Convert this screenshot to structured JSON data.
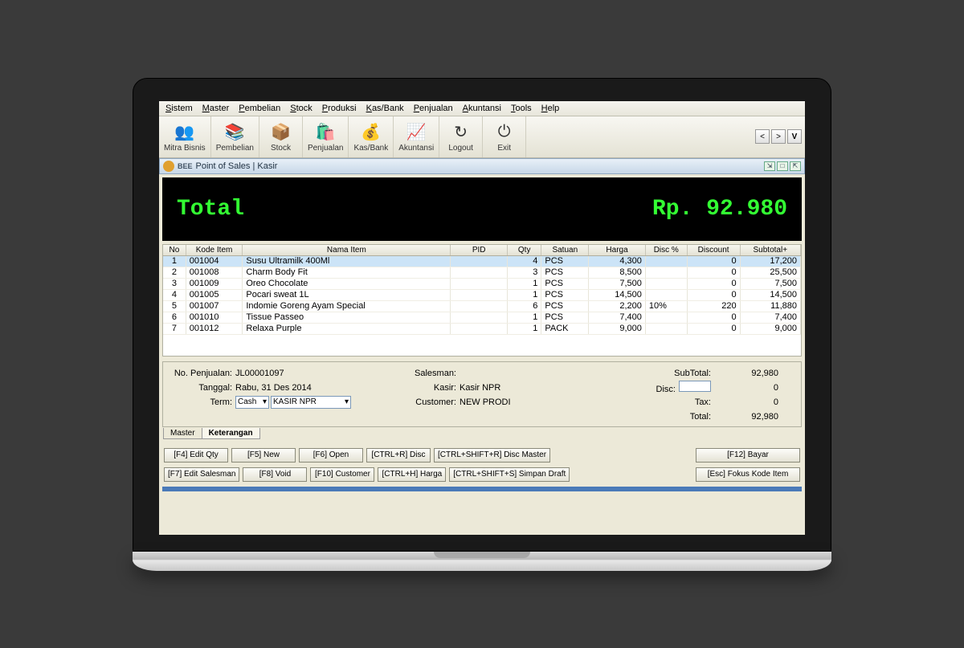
{
  "menubar": [
    "Sistem",
    "Master",
    "Pembelian",
    "Stock",
    "Produksi",
    "Kas/Bank",
    "Penjualan",
    "Akuntansi",
    "Tools",
    "Help"
  ],
  "toolbar": [
    {
      "label": "Mitra Bisnis",
      "icon": "👥"
    },
    {
      "label": "Pembelian",
      "icon": "📚"
    },
    {
      "label": "Stock",
      "icon": "📦"
    },
    {
      "label": "Penjualan",
      "icon": "🛍️"
    },
    {
      "label": "Kas/Bank",
      "icon": "💰"
    },
    {
      "label": "Akuntansi",
      "icon": "📈"
    },
    {
      "label": "Logout",
      "icon": "↻"
    },
    {
      "label": "Exit",
      "icon": "⏻"
    }
  ],
  "window_title": "Point of Sales | Kasir",
  "total_display": {
    "label": "Total",
    "value": "Rp. 92.980"
  },
  "columns": [
    "No",
    "Kode Item",
    "Nama Item",
    "PID",
    "Qty",
    "Satuan",
    "Harga",
    "Disc %",
    "Discount",
    "Subtotal+"
  ],
  "rows": [
    {
      "no": 1,
      "kode": "001004",
      "nama": "Susu Ultramilk 400Ml",
      "pid": "",
      "qty": 4,
      "satuan": "PCS",
      "harga": "4,300",
      "discp": "",
      "discount": "0",
      "subtotal": "17,200",
      "sel": true
    },
    {
      "no": 2,
      "kode": "001008",
      "nama": "Charm Body Fit",
      "pid": "",
      "qty": 3,
      "satuan": "PCS",
      "harga": "8,500",
      "discp": "",
      "discount": "0",
      "subtotal": "25,500"
    },
    {
      "no": 3,
      "kode": "001009",
      "nama": "Oreo Chocolate",
      "pid": "",
      "qty": 1,
      "satuan": "PCS",
      "harga": "7,500",
      "discp": "",
      "discount": "0",
      "subtotal": "7,500"
    },
    {
      "no": 4,
      "kode": "001005",
      "nama": "Pocari sweat 1L",
      "pid": "",
      "qty": 1,
      "satuan": "PCS",
      "harga": "14,500",
      "discp": "",
      "discount": "0",
      "subtotal": "14,500"
    },
    {
      "no": 5,
      "kode": "001007",
      "nama": "Indomie Goreng Ayam Special",
      "pid": "",
      "qty": 6,
      "satuan": "PCS",
      "harga": "2,200",
      "discp": "10%",
      "discount": "220",
      "subtotal": "11,880"
    },
    {
      "no": 6,
      "kode": "001010",
      "nama": "Tissue Passeo",
      "pid": "",
      "qty": 1,
      "satuan": "PCS",
      "harga": "7,400",
      "discp": "",
      "discount": "0",
      "subtotal": "7,400"
    },
    {
      "no": 7,
      "kode": "001012",
      "nama": "Relaxa Purple",
      "pid": "",
      "qty": 1,
      "satuan": "PACK",
      "harga": "9,000",
      "discp": "",
      "discount": "0",
      "subtotal": "9,000"
    }
  ],
  "info": {
    "no_penjualan_label": "No. Penjualan:",
    "no_penjualan": "JL00001097",
    "tanggal_label": "Tanggal:",
    "tanggal": "Rabu, 31 Des 2014",
    "term_label": "Term:",
    "term1": "Cash",
    "term2": "KASIR NPR",
    "salesman_label": "Salesman:",
    "salesman": "",
    "kasir_label": "Kasir:",
    "kasir": "Kasir NPR",
    "customer_label": "Customer:",
    "customer": "NEW PRODI",
    "subtotal_label": "SubTotal:",
    "subtotal": "92,980",
    "disc_label": "Disc:",
    "disc": "0",
    "tax_label": "Tax:",
    "tax": "0",
    "total_label": "Total:",
    "total": "92,980"
  },
  "tabs": {
    "master": "Master",
    "keterangan": "Keterangan"
  },
  "buttons_row1": [
    "[F4] Edit Qty",
    "[F5] New",
    "[F6] Open",
    "[CTRL+R] Disc",
    "[CTRL+SHIFT+R] Disc Master"
  ],
  "buttons_row1_right": [
    "[F12] Bayar"
  ],
  "buttons_row2": [
    "[F7] Edit Salesman",
    "[F8] Void",
    "[F10] Customer",
    "[CTRL+H] Harga",
    "[CTRL+SHIFT+S] Simpan Draft"
  ],
  "buttons_row2_right": [
    "[Esc] Fokus Kode Item"
  ],
  "nav_right": {
    "prev": "<",
    "next": ">",
    "v": "V"
  }
}
